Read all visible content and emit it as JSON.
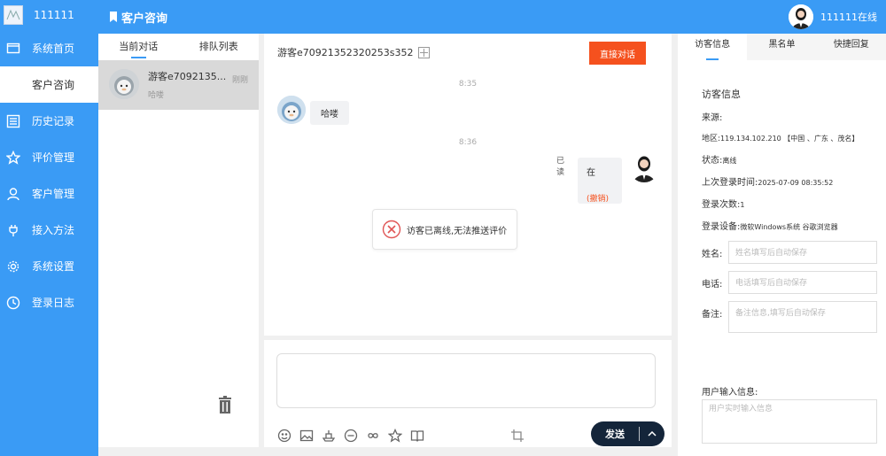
{
  "sidebar": {
    "username": "111111",
    "items": [
      {
        "label": "系统首页",
        "icon": "monitor-icon"
      },
      {
        "label": "客户咨询",
        "icon": "none"
      },
      {
        "label": "历史记录",
        "icon": "list-icon"
      },
      {
        "label": "评价管理",
        "icon": "star-icon"
      },
      {
        "label": "客户管理",
        "icon": "user-icon"
      },
      {
        "label": "接入方法",
        "icon": "plug-icon"
      },
      {
        "label": "系统设置",
        "icon": "gear-icon"
      },
      {
        "label": "登录日志",
        "icon": "clock-icon"
      }
    ],
    "active_index": 1
  },
  "topbar": {
    "title": "客户咨询",
    "agent_status": "111111在线"
  },
  "conv_list": {
    "tabs": [
      "当前对话",
      "排队列表"
    ],
    "active_tab": 0,
    "items": [
      {
        "name": "游客e7092135...",
        "preview": "哈喽",
        "time": "刚刚"
      }
    ]
  },
  "chat": {
    "visitor_name": "游客e70921352320253s352",
    "end_button": "直接对话",
    "messages": [
      {
        "time": "8:35",
        "side": "left",
        "text": "哈喽"
      },
      {
        "time": "8:36",
        "side": "right",
        "text": "在",
        "withdraw": "(撤销)",
        "read": "已读"
      }
    ],
    "toast": "访客已离线,无法推送评价"
  },
  "composer": {
    "send_label": "发送",
    "tools": [
      "emoji-icon",
      "image-icon",
      "ship-icon",
      "minus-circle-icon",
      "link-icon",
      "star-icon",
      "book-icon"
    ]
  },
  "info_panel": {
    "tabs": [
      "访客信息",
      "黑名单",
      "快捷回复"
    ],
    "active_tab": 0,
    "title": "访客信息",
    "source_label": "来源:",
    "region_label": "地区:",
    "region_value": "119.134.102.210 【中国 、广东 、茂名】",
    "status_label": "状态:",
    "status_value": "离线",
    "last_login_label": "上次登录时间:",
    "last_login_value": "2025-07-09 08:35:52",
    "login_count_label": "登录次数:",
    "login_count_value": "1",
    "device_label": "登录设备:",
    "device_value": "微软Windows系统 谷歌浏览器",
    "name_label": "姓名:",
    "name_placeholder": "姓名填写后自动保存",
    "phone_label": "电话:",
    "phone_placeholder": "电话填写后自动保存",
    "note_label": "备注:",
    "note_placeholder": "备注信息,填写后自动保存",
    "user_input_label": "用户输入信息:",
    "user_input_placeholder": "用户实时输入信息"
  }
}
